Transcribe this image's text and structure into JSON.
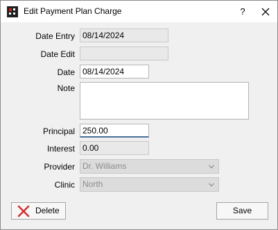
{
  "window": {
    "title": "Edit Payment Plan Charge",
    "help": "?"
  },
  "fields": {
    "date_entry": {
      "label": "Date Entry",
      "value": "08/14/2024"
    },
    "date_edit": {
      "label": "Date Edit",
      "value": ""
    },
    "date": {
      "label": "Date",
      "value": "08/14/2024"
    },
    "note": {
      "label": "Note",
      "value": ""
    },
    "principal": {
      "label": "Principal",
      "value": "250.00"
    },
    "interest": {
      "label": "Interest",
      "value": "0.00"
    },
    "provider": {
      "label": "Provider",
      "value": "Dr. Williams"
    },
    "clinic": {
      "label": "Clinic",
      "value": "North"
    }
  },
  "buttons": {
    "delete": "Delete",
    "save": "Save"
  },
  "icons": {
    "app": "grid-app-icon",
    "close": "close-icon",
    "delete": "red-x-icon",
    "dropdown": "chevron-down-icon"
  },
  "colors": {
    "delete_x": "#d32f2f",
    "focus_underline": "#4a6f9a"
  }
}
